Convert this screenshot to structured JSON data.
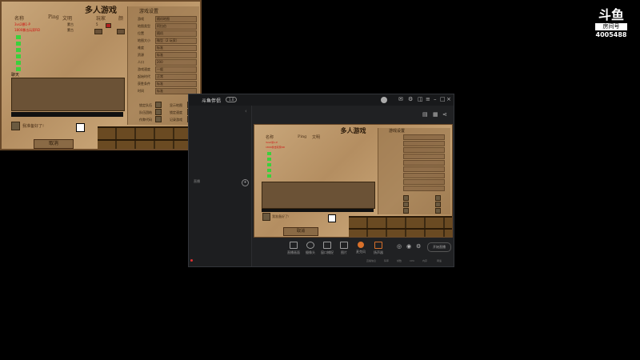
{
  "game": {
    "title": "多人游戏",
    "col_name": "名称",
    "col_ping": "Ping",
    "col_civ": "文明",
    "col_team": "玩家",
    "col_color": "颜",
    "players": [
      {
        "name": "3vs2暴1-P",
        "civ": "蒙古",
        "team": "5"
      },
      {
        "name": "1800暴击玩家RD",
        "civ": "蒙古",
        "team": "2"
      }
    ],
    "chat_label": "聊天",
    "ready_label": "我准备好了!",
    "cancel_label": "取消",
    "settings_header": "游戏设置",
    "settings": [
      {
        "label": "游戏",
        "value": "随机地图"
      },
      {
        "label": "地图类型",
        "value": "阿拉伯"
      },
      {
        "label": "位置",
        "value": "随机"
      },
      {
        "label": "地图大小",
        "value": "微型（2 玩家）"
      },
      {
        "label": "难度",
        "value": "标准"
      },
      {
        "label": "资源",
        "value": "标准"
      },
      {
        "label": "人口",
        "value": "200"
      },
      {
        "label": "游戏速度",
        "value": "一般"
      },
      {
        "label": "起始时代",
        "value": "正常"
      },
      {
        "label": "获胜条件",
        "value": "标准"
      },
      {
        "label": "时间",
        "value": "标准"
      }
    ],
    "options": [
      {
        "label": "锁定队伍",
        "right": "显示地图"
      },
      {
        "label": "队伍团结",
        "right": "锁定速度"
      },
      {
        "label": "作弊代码",
        "right": "记录游戏"
      }
    ]
  },
  "app": {
    "title": "斗鱼伴侣",
    "badge": "1.0",
    "side_label": "直播",
    "toolbar": [
      {
        "label": "直播画面",
        "icon": "screen-icon"
      },
      {
        "label": "摄像头",
        "icon": "camera-icon"
      },
      {
        "label": "窗口捕捉",
        "icon": "window-icon"
      },
      {
        "label": "图片",
        "icon": "image-icon"
      },
      {
        "label": "麦克风",
        "icon": "mic-icon"
      },
      {
        "label": "扬声器",
        "icon": "speaker-icon"
      }
    ],
    "start_button": "开始直播",
    "status": [
      "直播信息",
      "码率",
      "帧数",
      "CPU",
      "内存",
      "网速"
    ]
  },
  "brand": {
    "logo": "斗鱼",
    "room_label": "房间号",
    "room_id": "4005488"
  }
}
